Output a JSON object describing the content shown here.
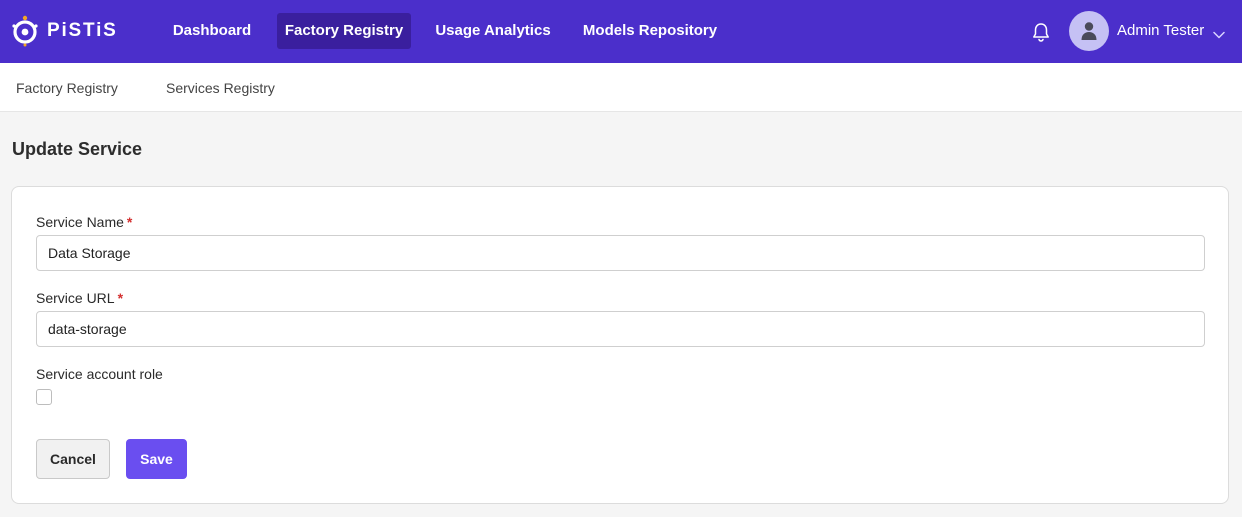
{
  "app": {
    "logo_text": "PiSTiS"
  },
  "nav": {
    "items": [
      {
        "label": "Dashboard"
      },
      {
        "label": "Factory Registry"
      },
      {
        "label": "Usage Analytics"
      },
      {
        "label": "Models Repository"
      }
    ],
    "active_item": "Factory Registry"
  },
  "user": {
    "name": "Admin Tester"
  },
  "subnav": {
    "items": [
      {
        "label": "Factory Registry"
      },
      {
        "label": "Services Registry"
      }
    ]
  },
  "page": {
    "title": "Update Service"
  },
  "form": {
    "service_name": {
      "label": "Service Name",
      "required_mark": "*",
      "value": "Data Storage"
    },
    "service_url": {
      "label": "Service URL",
      "required_mark": "*",
      "value": "data-storage"
    },
    "service_account_role": {
      "label": "Service account role",
      "checked": false
    },
    "cancel_label": "Cancel",
    "save_label": "Save"
  },
  "icons": {
    "logo": "pistis-logo-icon",
    "notifications": "bell-icon",
    "avatar": "user-icon",
    "user_menu": "chevron-down-icon"
  },
  "colors": {
    "topbar": "#4b2fcb",
    "active_nav": "#3a1f9e",
    "primary_button": "#6a4ef0",
    "required": "#d32f2f",
    "avatar_bg": "#c5c1f4"
  }
}
